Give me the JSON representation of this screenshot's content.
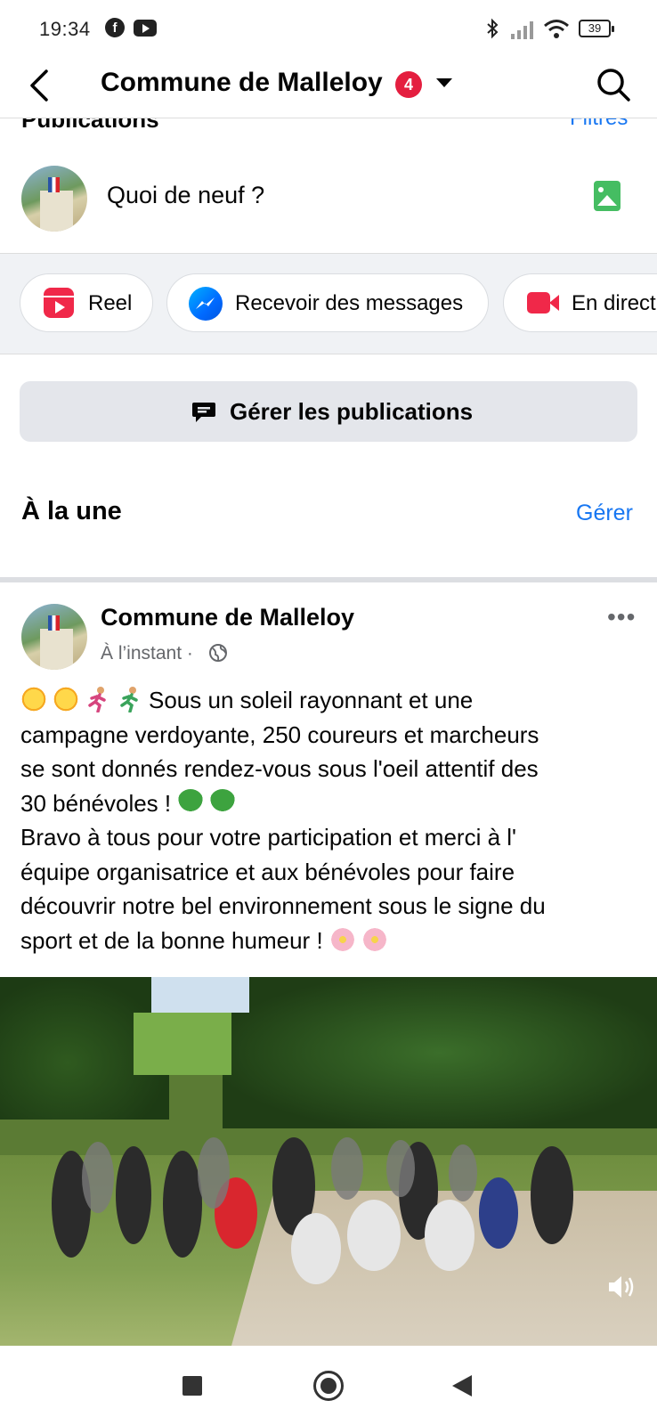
{
  "status_bar": {
    "time": "19:34",
    "battery": "39",
    "icons": [
      "facebook-icon",
      "youtube-icon",
      "bluetooth-icon",
      "signal-icon",
      "wifi-icon",
      "battery-icon"
    ]
  },
  "header": {
    "title": "Commune de Malleloy",
    "badge_count": "4",
    "partial_left": "Publications",
    "partial_right": "Filtres"
  },
  "composer": {
    "placeholder": "Quoi de neuf ?"
  },
  "actions": {
    "reel_label": "Reel",
    "messages_label": "Recevoir des messages",
    "live_label": "En direct"
  },
  "manage": {
    "label": "Gérer les publications"
  },
  "featured": {
    "title": "À la une",
    "manage_label": "Gérer"
  },
  "post": {
    "author": "Commune de Malleloy",
    "time": "À l’instant ·",
    "lines": [
      "Sous un soleil rayonnant et une",
      "campagne verdoyante, 250 coureurs et marcheurs",
      "se sont donnés rendez-vous sous l'oeil attentif des",
      "30 bénévoles !",
      " Bravo à tous pour votre participation et merci à l'",
      "équipe organisatrice et aux bénévoles pour faire",
      "découvrir notre bel environnement sous le signe du",
      "sport et de la bonne humeur !"
    ],
    "more_label": "•••"
  },
  "colors": {
    "fb_blue": "#1877f2",
    "badge_red": "#e41e3f",
    "chip_bg": "#f0f2f5",
    "button_gray": "#e4e6eb"
  }
}
